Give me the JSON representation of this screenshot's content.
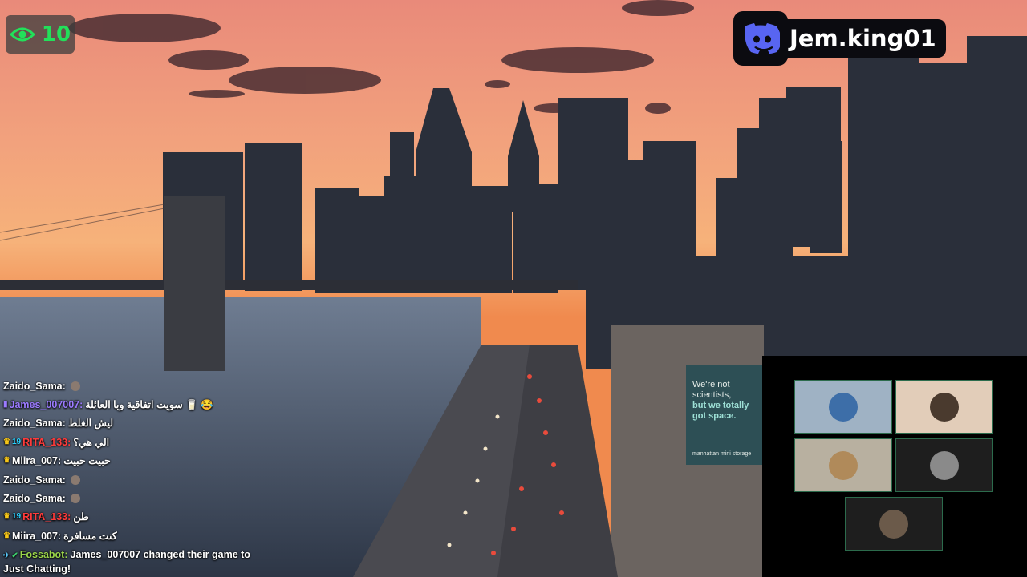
{
  "viewer_count": {
    "icon": "eye-icon",
    "value": "10",
    "color": "#22e05a"
  },
  "discord": {
    "icon": "discord-icon",
    "username": "Jem.king01",
    "brand_color": "#5865F2"
  },
  "billboard": {
    "line1": "We're not",
    "line2": "scientists,",
    "line3": "but we totally",
    "line4": "got space.",
    "brand": "manhattan mini storage"
  },
  "chat": [
    {
      "badges": [],
      "user": "Zaido_Sama",
      "user_color": "#ffffff",
      "text": "",
      "emoji": true
    },
    {
      "badges": [
        "purple-badge"
      ],
      "user": "James_007007",
      "user_color": "#9b7bff",
      "text": "سويت اتفاقية وبا العائلة 🥛 😂"
    },
    {
      "badges": [],
      "user": "Zaido_Sama",
      "user_color": "#ffffff",
      "text": "ليش الغلط"
    },
    {
      "badges": [
        "crown",
        "19"
      ],
      "user": "RITA_133",
      "user_color": "#ff3b3b",
      "text": "الي هي؟"
    },
    {
      "badges": [
        "crown"
      ],
      "user": "Miira_007",
      "user_color": "#ffffff",
      "text": "حبيت حبيت"
    },
    {
      "badges": [],
      "user": "Zaido_Sama",
      "user_color": "#ffffff",
      "text": "",
      "emoji": true
    },
    {
      "badges": [],
      "user": "Zaido_Sama",
      "user_color": "#ffffff",
      "text": "",
      "emoji": true
    },
    {
      "badges": [
        "crown",
        "19"
      ],
      "user": "RITA_133",
      "user_color": "#ff3b3b",
      "text": "طن"
    },
    {
      "badges": [
        "crown"
      ],
      "user": "Miira_007",
      "user_color": "#ffffff",
      "text": "كنت مسافرة"
    },
    {
      "badges": [
        "tool",
        "verified"
      ],
      "user": "Fossabot",
      "user_color": "#9bd64a",
      "text": "James_007007 changed their game to Just Chatting!"
    }
  ],
  "camera_grid": {
    "tiles": [
      {
        "name": "participant-1",
        "bg": "#9fb2c4",
        "avatar": "#3d6ea8"
      },
      {
        "name": "participant-2",
        "bg": "#e2cdb9",
        "avatar": "#4a3a2e"
      },
      {
        "name": "participant-3",
        "bg": "#b8b0a0",
        "avatar": "#b08a5a"
      },
      {
        "name": "participant-4",
        "bg": "#1e1e1e",
        "avatar": "#8a8a8a"
      },
      {
        "name": "participant-5",
        "bg": "#1e1e1e",
        "avatar": "#6b5a4a"
      }
    ]
  }
}
